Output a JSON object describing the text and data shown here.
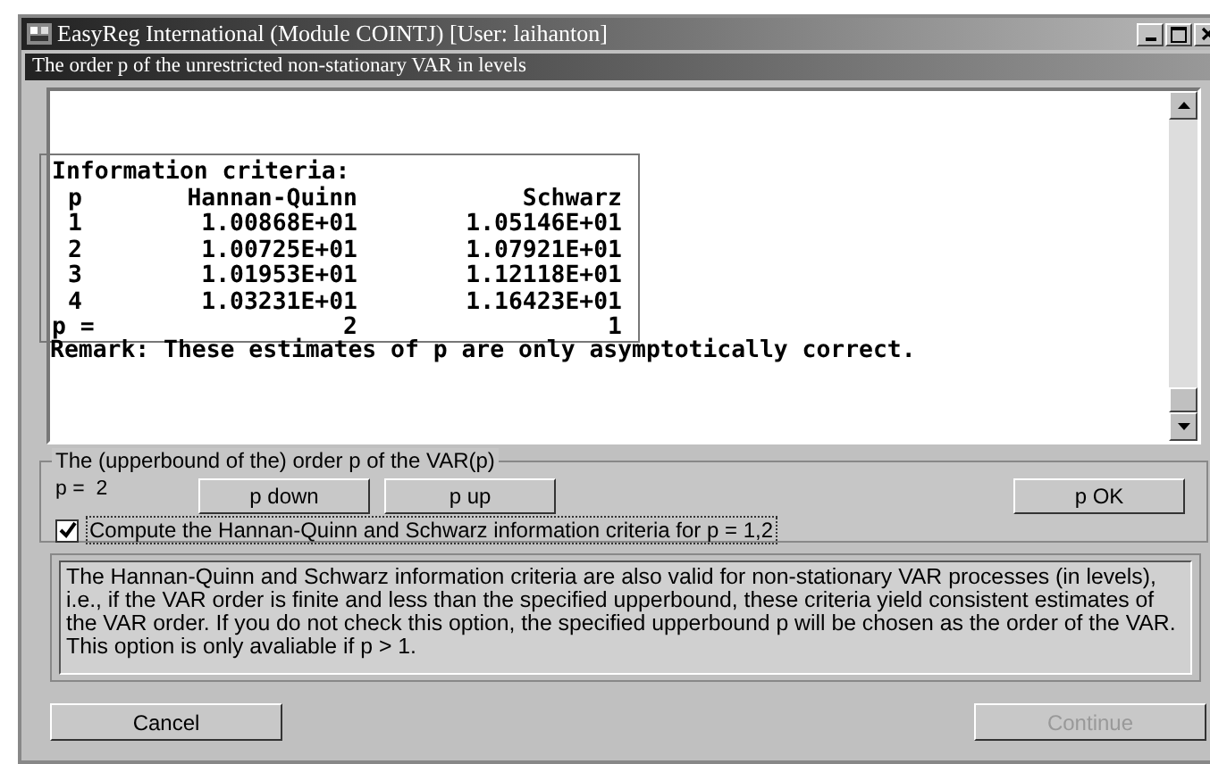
{
  "window": {
    "title": "EasyReg International (Module COINTJ) [User: laihanton]"
  },
  "caption": "The order p of the unrestricted non-stationary VAR in levels",
  "output": {
    "heading": "Information criteria:",
    "columns": [
      "p",
      "Hannan-Quinn",
      "Schwarz"
    ],
    "rows": [
      [
        "1",
        "1.00868E+01",
        "1.05146E+01"
      ],
      [
        "2",
        "1.00725E+01",
        "1.07921E+01"
      ],
      [
        "3",
        "1.01953E+01",
        "1.12118E+01"
      ],
      [
        "4",
        "1.03231E+01",
        "1.16423E+01"
      ],
      [
        "p =",
        "2",
        "1"
      ]
    ],
    "remark": "Remark: These estimates of p are only asymptotically correct."
  },
  "group": {
    "title": "The (upperbound of the) order p of the VAR(p)",
    "p_label": "p =  2",
    "buttons": [
      {
        "label": "p down"
      },
      {
        "label": "p up"
      }
    ],
    "ok_button": "p OK",
    "checkbox": {
      "label": "Compute the Hannan-Quinn and Schwarz information criteria for p = 1,2",
      "checked": true
    }
  },
  "description": "The  Hannan-Quinn and Schwarz information criteria are also valid for non-stationary VAR processes (in levels), i.e., if the VAR order is finite and less than the specified upperbound, these criteria yield consistent estimates of the VAR order. If you do not check this option, the specified upperbound p will be chosen as the order of the VAR. This option is only avaliable if p > 1.",
  "buttons": [
    {
      "label": "Cancel",
      "disabled": false
    },
    {
      "label": "Continue",
      "disabled": true
    }
  ]
}
